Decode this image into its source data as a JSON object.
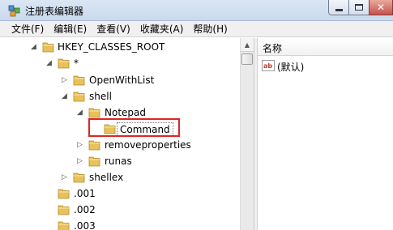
{
  "window": {
    "title": "注册表编辑器",
    "icon": "regedit-icon",
    "controls": [
      "minimize",
      "maximize",
      "close"
    ]
  },
  "menu": [
    "文件(F)",
    "编辑(E)",
    "查看(V)",
    "收藏夹(A)",
    "帮助(H)"
  ],
  "tree": {
    "root": "HKEY_CLASSES_ROOT",
    "star": "*",
    "open_with_list": "OpenWithList",
    "shell": "shell",
    "notepad": "Notepad",
    "command": "Command",
    "removeproperties": "removeproperties",
    "runas": "runas",
    "shellex": "shellex",
    "ext_001": ".001",
    "ext_002": ".002",
    "ext_003": ".003",
    "selected": "Command"
  },
  "values_pane": {
    "column_name": "名称",
    "rows": [
      {
        "icon": "string-value-icon",
        "name": "(默认)"
      }
    ]
  },
  "colors": {
    "highlight_box": "#e02424",
    "folder": "#e8c15a"
  }
}
